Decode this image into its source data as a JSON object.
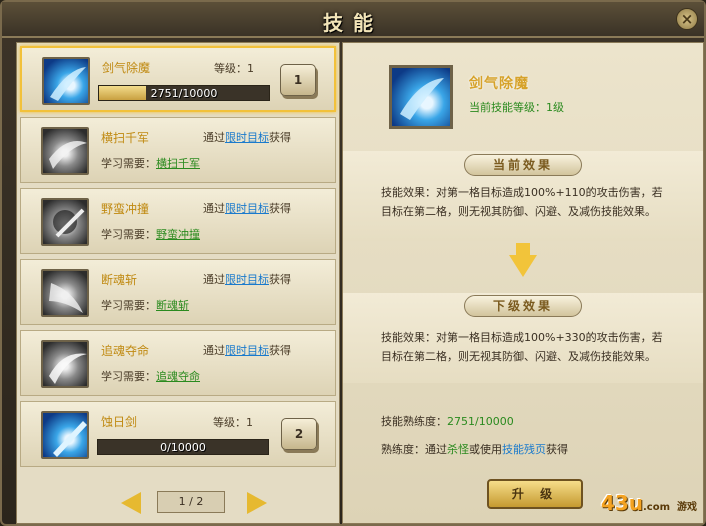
{
  "window": {
    "title": "技能",
    "close_label": "×"
  },
  "skills": [
    {
      "name": "剑气除魔",
      "level_label": "等级：1",
      "xp": "2751/10000",
      "progress": 0.2751,
      "slot": "1",
      "icon": "blue-swirl-icon"
    },
    {
      "name": "横扫千军",
      "acquire_prefix": "通过",
      "acquire_link": "限时目标",
      "acquire_suffix": "获得",
      "req_label": "学习需要：",
      "req_link": "横扫千军",
      "icon": "gray-slash-icon"
    },
    {
      "name": "野蛮冲撞",
      "acquire_prefix": "通过",
      "acquire_link": "限时目标",
      "acquire_suffix": "获得",
      "req_label": "学习需要：",
      "req_link": "野蛮冲撞",
      "icon": "gray-charge-icon"
    },
    {
      "name": "断魂斩",
      "acquire_prefix": "通过",
      "acquire_link": "限时目标",
      "acquire_suffix": "获得",
      "req_label": "学习需要：",
      "req_link": "断魂斩",
      "icon": "gray-slash-icon"
    },
    {
      "name": "追魂夺命",
      "acquire_prefix": "通过",
      "acquire_link": "限时目标",
      "acquire_suffix": "获得",
      "req_label": "学习需要：",
      "req_link": "追魂夺命",
      "icon": "gray-swirl-icon"
    },
    {
      "name": "蚀日剑",
      "level_label": "等级：1",
      "xp": "0/10000",
      "progress": 0,
      "slot": "2",
      "icon": "blue-sword-icon"
    }
  ],
  "pager": {
    "text": "1 / 2"
  },
  "detail": {
    "name": "剑气除魔",
    "level": "当前技能等级：1级",
    "current_header": "当前效果",
    "current_effect": "技能效果：对第一格目标造成100%+110的攻击伤害，若目标在第二格，则无视其防御、闪避、及减伤技能效果。",
    "next_header": "下级效果",
    "next_effect": "技能效果：对第一格目标造成100%+330的攻击伤害，若目标在第二格，则无视其防御、闪避、及减伤技能效果。",
    "proficiency_label": "技能熟练度：",
    "proficiency_value": "2751/10000",
    "tip_prefix": "熟练度：通过",
    "tip_link1": "杀怪",
    "tip_mid": "或使用",
    "tip_link2": "技能残页",
    "tip_suffix": "获得",
    "upgrade_label": "升 级"
  },
  "watermark": {
    "brand": "43u",
    "suffix": ".com",
    "tag": "游戏"
  },
  "colors": {
    "gold": "#f2c13a",
    "green": "#2a8a1e",
    "blue": "#1a7acc"
  }
}
